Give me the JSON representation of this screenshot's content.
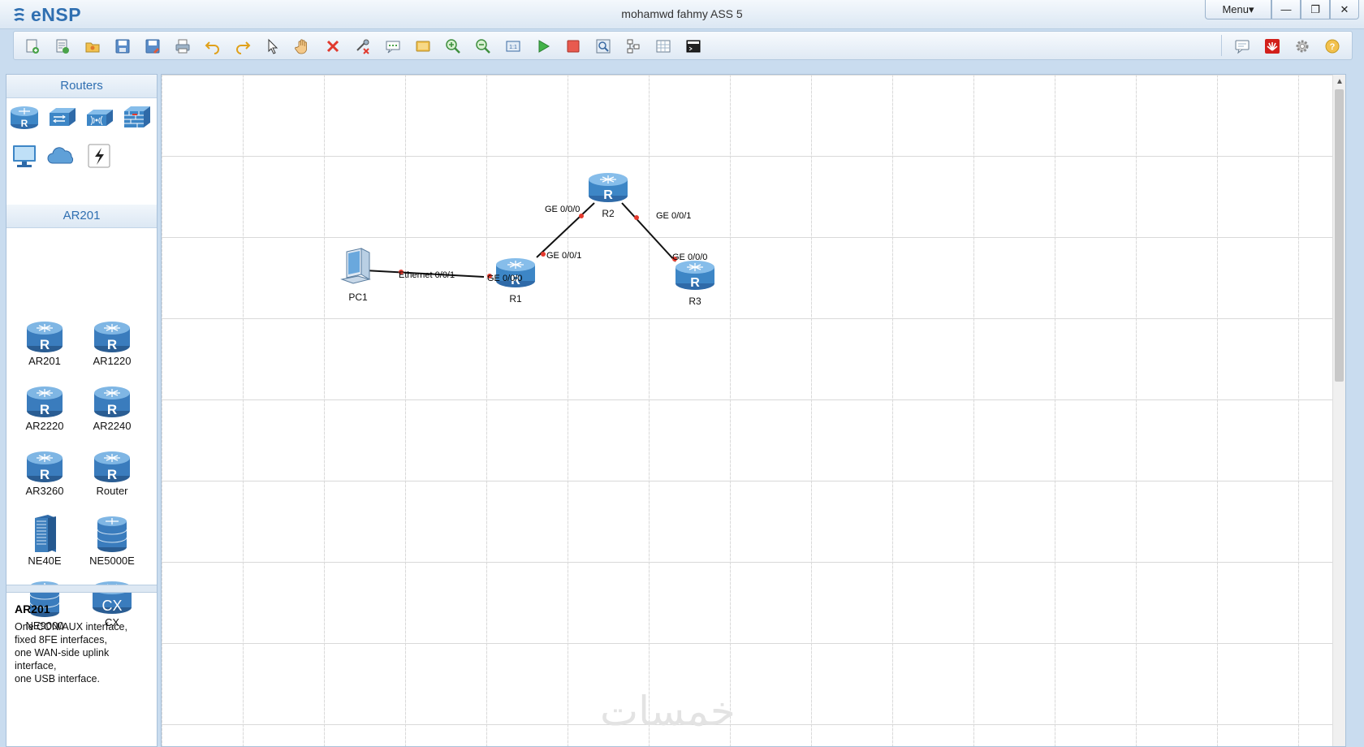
{
  "app": {
    "name": "eNSP",
    "window_title": "mohamwd fahmy ASS 5"
  },
  "window_controls": {
    "menu_label": "Menu▾",
    "minimize": "—",
    "restore": "❐",
    "close": "✕"
  },
  "toolbar": {
    "left": [
      "new-topology-icon",
      "new-example-icon",
      "open-icon",
      "save-icon",
      "save-as-icon",
      "print-icon",
      "undo-icon",
      "redo-icon",
      "select-icon",
      "pan-hand-icon",
      "delete-icon",
      "delete-link-icon",
      "text-note-icon",
      "palette-icon",
      "zoom-in-icon",
      "zoom-out-icon",
      "fit-view-icon",
      "start-device-icon",
      "stop-device-icon",
      "capture-icon",
      "topology-icon",
      "grid-icon",
      "console-icon"
    ],
    "right": [
      "chat-icon",
      "huawei-icon",
      "settings-icon",
      "help-icon"
    ]
  },
  "left_panel": {
    "category_header": "Routers",
    "categories": [
      "router-category-icon",
      "switch-category-icon",
      "wlan-category-icon",
      "firewall-category-icon",
      "end-device-category-icon",
      "cloud-category-icon",
      "link-category-icon"
    ],
    "device_header": "AR201",
    "devices": [
      {
        "label": "AR201",
        "kind": "router"
      },
      {
        "label": "AR1220",
        "kind": "router"
      },
      {
        "label": "AR2220",
        "kind": "router"
      },
      {
        "label": "AR2240",
        "kind": "router"
      },
      {
        "label": "AR3260",
        "kind": "router"
      },
      {
        "label": "Router",
        "kind": "router"
      },
      {
        "label": "NE40E",
        "kind": "chassis"
      },
      {
        "label": "NE5000E",
        "kind": "stack"
      },
      {
        "label": "NE9000",
        "kind": "stack"
      },
      {
        "label": "CX",
        "kind": "cx"
      }
    ],
    "description": {
      "title": "AR201",
      "body": "One CON/AUX interface,\nfixed 8FE interfaces,\none WAN-side uplink\ninterface,\none USB interface."
    }
  },
  "topology": {
    "nodes": [
      {
        "id": "PC1",
        "label": "PC1",
        "kind": "pc"
      },
      {
        "id": "R1",
        "label": "R1",
        "kind": "router"
      },
      {
        "id": "R2",
        "label": "R2",
        "kind": "router"
      },
      {
        "id": "R3",
        "label": "R3",
        "kind": "router"
      }
    ],
    "links": [
      {
        "from": "PC1",
        "to": "R1",
        "from_if": "Ethernet 0/0/1",
        "to_if": "GE 0/0/0"
      },
      {
        "from": "R1",
        "to": "R2",
        "from_if": "GE 0/0/1",
        "to_if": "GE 0/0/0"
      },
      {
        "from": "R2",
        "to": "R3",
        "from_if": "GE 0/0/1",
        "to_if": "GE 0/0/0"
      }
    ]
  },
  "watermark": "خمسات",
  "colors": {
    "accent": "#2f6fb1",
    "link_dot": "#e53a2e",
    "router_blue": "#3d86c6"
  }
}
